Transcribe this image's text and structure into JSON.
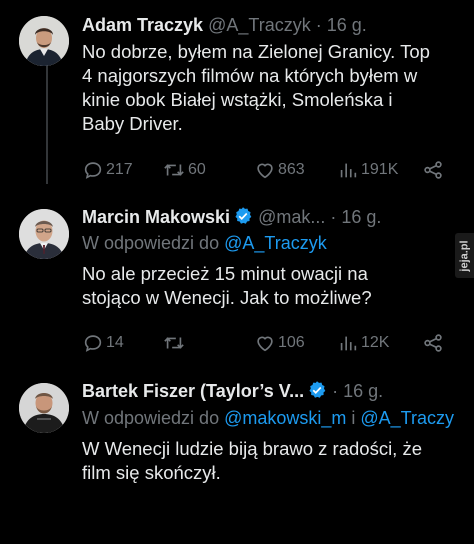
{
  "tweets": [
    {
      "name": "Adam Traczyk",
      "handle": "@A_Traczyk",
      "dot": "·",
      "time": "16 g.",
      "lines": [
        "No dobrze, byłem na Zielonej Granicy. Top",
        "4 najgorszych filmów na których byłem w",
        "kinie obok Białej wstążki, Smoleńska i",
        "Baby Driver."
      ],
      "replies": "217",
      "retweets": "60",
      "likes": "863",
      "views": "191K"
    },
    {
      "name": "Marcin Makowski",
      "handle": "@mak...",
      "dot": "·",
      "time": "16 g.",
      "reply_prefix": "W odpowiedzi do ",
      "reply_mention": "@A_Traczyk",
      "lines": [
        "No ale przecież 15 minut owacji na",
        "stojąco w Wenecji. Jak to możliwe?"
      ],
      "replies": "14",
      "retweets": "",
      "likes": "106",
      "views": "12K"
    },
    {
      "name": "Bartek Fiszer (Taylor’s V...",
      "handle": "",
      "dot": "·",
      "time": "16 g.",
      "reply_prefix": "W odpowiedzi do ",
      "reply_mention": "@makowski_m",
      "reply_join": " i ",
      "reply_mention2": "@A_Traczy",
      "lines": [
        "W Wenecji ludzie biją brawo z radości, że",
        "film się skończył."
      ]
    }
  ],
  "watermark": "jeja.pl",
  "colors": {
    "background": "#000000",
    "text": "#e7e9ea",
    "muted": "#71767b",
    "link": "#1d9bf0",
    "verified": "#1d9bf0"
  },
  "icons": [
    "reply-icon",
    "retweet-icon",
    "like-icon",
    "views-icon",
    "share-icon",
    "verified-badge-icon"
  ]
}
